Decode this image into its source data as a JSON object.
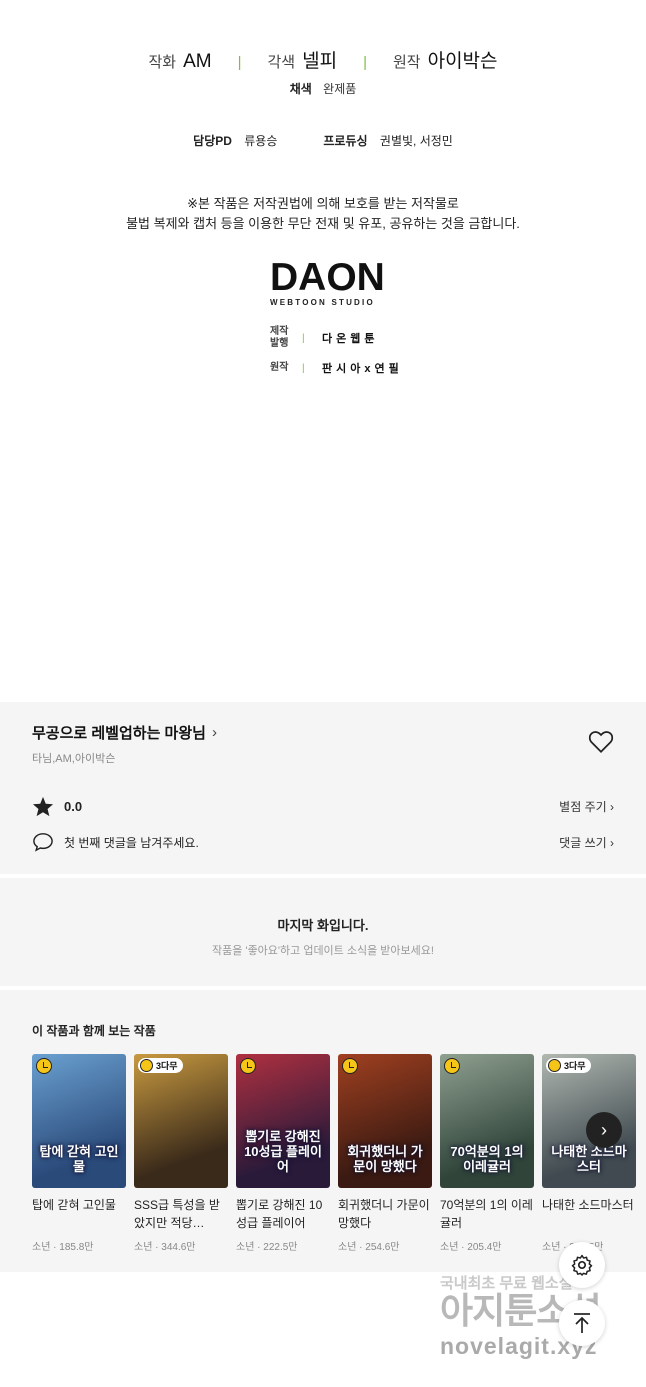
{
  "credits": {
    "main": [
      {
        "role": "작화",
        "name": "AM"
      },
      {
        "role": "각색",
        "name": "넬피"
      },
      {
        "role": "원작",
        "name": "아이박슨"
      }
    ],
    "coloring": {
      "role": "채색",
      "name": "완제품"
    },
    "staff": [
      {
        "role": "담당PD",
        "name": "류용승"
      },
      {
        "role": "프로듀싱",
        "name": "권별빛, 서정민"
      }
    ],
    "notice_line1": "※본 작품은 저작권법에 의해 보호를 받는 저작물로",
    "notice_line2": "불법 복제와 캡처 등을 이용한 무단 전재 및 유포, 공유하는 것을 금합니다.",
    "logo_big": "DAON",
    "logo_small": "WEBTOON STUDIO",
    "production": [
      {
        "label": "제작\n발행",
        "label1": "제작",
        "label2": "발행",
        "value": "다온웹툰"
      },
      {
        "label1": "원작",
        "label2": "",
        "value": "판시아x연필"
      }
    ]
  },
  "info": {
    "series_title": "무공으로 레벨업하는 마왕님",
    "authors": "타님,AM,아이박슨",
    "rating": "0.0",
    "rate_action": "별점 주기",
    "comment_prompt": "첫 번째 댓글을 남겨주세요.",
    "comment_action": "댓글 쓰기"
  },
  "last_episode": {
    "title": "마지막 화입니다.",
    "subtitle": "작품을 '좋아요'하고 업데이트 소식을 받아보세요!"
  },
  "recommendations": {
    "heading": "이 작품과 함께 보는 작품",
    "items": [
      {
        "title": "탑에 갇혀 고인물",
        "meta": "소년 · 185.8만",
        "badge": "",
        "cover_text": "탑에 갇혀 고인물",
        "colors": [
          "#2a4a7a",
          "#6aa0d0"
        ]
      },
      {
        "title": "SSS급 특성을 받았지만 적당…",
        "meta": "소년 · 344.6만",
        "badge": "3다무",
        "cover_text": "",
        "colors": [
          "#3a2a1a",
          "#c89a40"
        ]
      },
      {
        "title": "뽑기로 강해진 10성급 플레이어",
        "meta": "소년 · 222.5만",
        "badge": "",
        "cover_text": "뽑기로 강해진 10성급 플레이어",
        "colors": [
          "#2a1a3a",
          "#b03040"
        ]
      },
      {
        "title": "회귀했더니 가문이 망했다",
        "meta": "소년 · 254.6만",
        "badge": "",
        "cover_text": "회귀했더니 가문이 망했다",
        "colors": [
          "#3a1a12",
          "#a04020"
        ]
      },
      {
        "title": "70억분의 1의 이레귤러",
        "meta": "소년 · 205.4만",
        "badge": "",
        "cover_text": "70억분의 1의 이레귤러",
        "colors": [
          "#30443a",
          "#8fa090"
        ]
      },
      {
        "title": "나태한 소드마스터",
        "meta": "소년 · 264.5만",
        "badge": "3다무",
        "cover_text": "나태한 소드마스터",
        "colors": [
          "#404a50",
          "#b0b8b0"
        ]
      }
    ]
  },
  "watermark": {
    "line1": "국내최초 무료 웹소설",
    "line2": "아지툰소설",
    "line3": "novelagit.xyz"
  }
}
